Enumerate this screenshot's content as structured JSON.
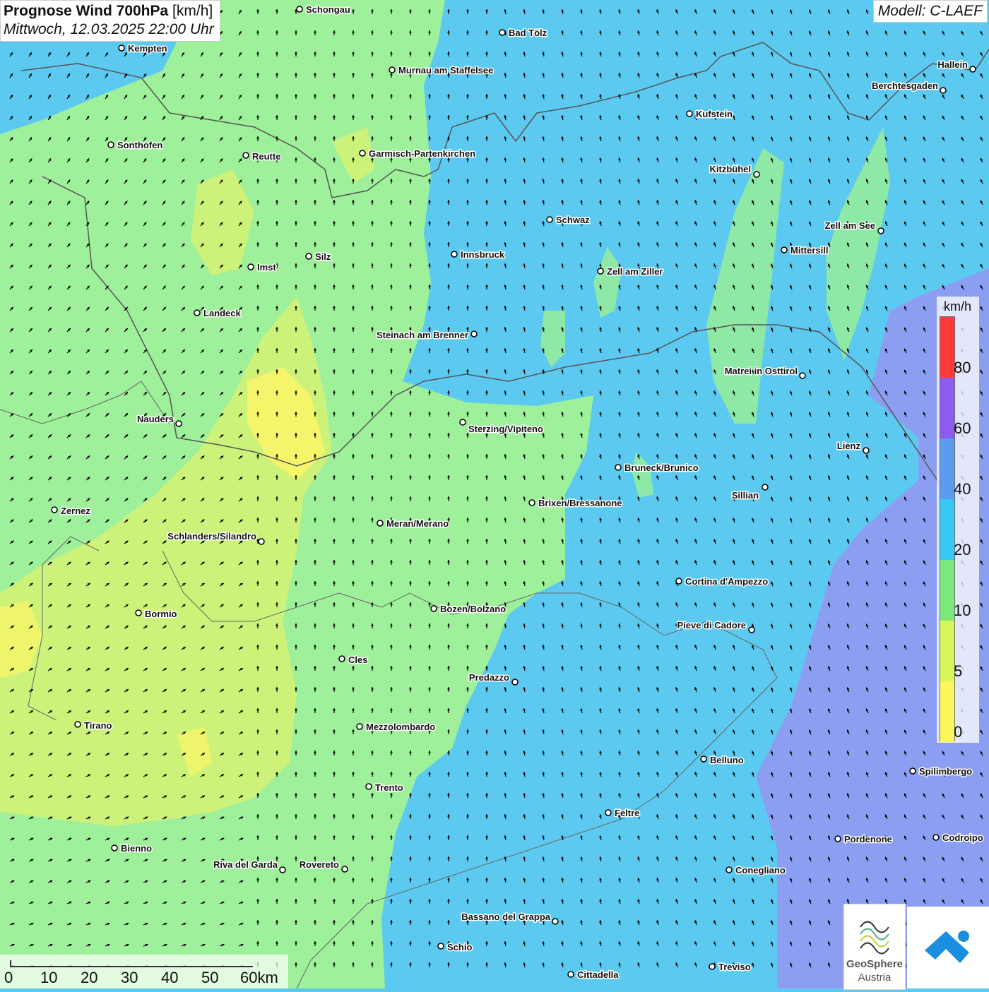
{
  "title": {
    "main": "Prognose Wind 700hPa",
    "unit": "[km/h]",
    "datetime": "Mittwoch, 12.03.2025 22:00 Uhr"
  },
  "model": "Modell: C-LAEF",
  "legend": {
    "unit": "km/h",
    "ticks": [
      "80",
      "60",
      "40",
      "20",
      "10",
      "5",
      "0"
    ],
    "colors": [
      "#ff3b3b",
      "#8e5bf0",
      "#5b9cf0",
      "#39c8f3",
      "#7ce87c",
      "#d8f55b",
      "#fdf75b"
    ]
  },
  "scale_bar": {
    "labels": [
      "0",
      "10",
      "20",
      "30",
      "40",
      "50",
      "60km"
    ]
  },
  "logos": {
    "geosphere_name": "GeoSphere",
    "geosphere_sub": "Austria",
    "app_icon": "weather-app-icon"
  },
  "colors": {
    "calm_yellow": "#f5f56b",
    "light_green": "#9ef09a",
    "mid_green": "#7fe3a0",
    "blue": "#5ccaf0",
    "violet": "#8c9ef2"
  },
  "cities": [
    {
      "name": "Schongau"
    },
    {
      "name": "Bad Tölz"
    },
    {
      "name": "Kempten"
    },
    {
      "name": "Murnau am Staffelsee"
    },
    {
      "name": "Hallein"
    },
    {
      "name": "Berchtesgaden"
    },
    {
      "name": "Kufstein"
    },
    {
      "name": "Sonthofen"
    },
    {
      "name": "Reutte"
    },
    {
      "name": "Garmisch-Partenkirchen"
    },
    {
      "name": "Kitzbühel"
    },
    {
      "name": "Schwaz"
    },
    {
      "name": "Zell am See"
    },
    {
      "name": "Mittersill"
    },
    {
      "name": "Innsbruck"
    },
    {
      "name": "Silz"
    },
    {
      "name": "Imst"
    },
    {
      "name": "Zell am Ziller"
    },
    {
      "name": "Landeck"
    },
    {
      "name": "Steinach am Brenner"
    },
    {
      "name": "Matrei in Osttirol"
    },
    {
      "name": "Nauders"
    },
    {
      "name": "Sterzing/Vipiteno"
    },
    {
      "name": "Lienz"
    },
    {
      "name": "Bruneck/Brunico"
    },
    {
      "name": "Sillian"
    },
    {
      "name": "Zernez"
    },
    {
      "name": "Brixen/Bressanone"
    },
    {
      "name": "Meran/Merano"
    },
    {
      "name": "Schlanders/Silandro"
    },
    {
      "name": "Cortina d'Ampezzo"
    },
    {
      "name": "Bozen/Bolzano"
    },
    {
      "name": "Bormio"
    },
    {
      "name": "Pieve di Cadore"
    },
    {
      "name": "Cles"
    },
    {
      "name": "Predazzo"
    },
    {
      "name": "Tirano"
    },
    {
      "name": "Mezzolombardo"
    },
    {
      "name": "Belluno"
    },
    {
      "name": "Spilimbergo"
    },
    {
      "name": "Trento"
    },
    {
      "name": "Feltre"
    },
    {
      "name": "Pordenone"
    },
    {
      "name": "Codroipo"
    },
    {
      "name": "Bienno"
    },
    {
      "name": "Riva del Garda"
    },
    {
      "name": "Rovereto"
    },
    {
      "name": "Conegliano"
    },
    {
      "name": "Bassano del Grappa"
    },
    {
      "name": "Schio"
    },
    {
      "name": "Treviso"
    },
    {
      "name": "Cittadella"
    }
  ]
}
